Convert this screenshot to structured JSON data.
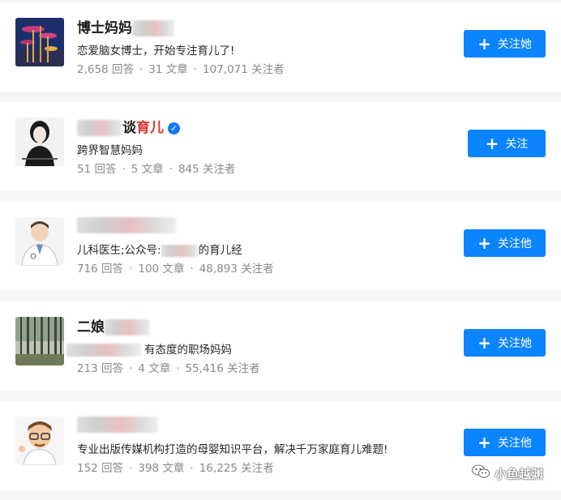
{
  "users": [
    {
      "name": "博士妈妈",
      "name_accent": "",
      "verified": false,
      "bio": "恋爱脑女博士，开始专注育儿了!",
      "answers": "2,658 回答",
      "articles": "31 文章",
      "followers": "107,071 关注者",
      "button_label": "关注她",
      "avatar_icon": "sculpture-avatar"
    },
    {
      "name": "谈",
      "name_accent": "育儿",
      "verified": true,
      "bio": "跨界智慧妈妈",
      "answers": "51 回答",
      "articles": "5 文章",
      "followers": "845 关注者",
      "button_label": "关注",
      "avatar_icon": "woman-sketch-avatar"
    },
    {
      "name": "",
      "name_accent": "",
      "verified": false,
      "bio_prefix": "儿科医生;公众号:",
      "bio_suffix": "的育儿经",
      "answers": "716 回答",
      "articles": "100 文章",
      "followers": "48,893 关注者",
      "button_label": "关注他",
      "avatar_icon": "doctor-avatar"
    },
    {
      "name": "二娘",
      "name_accent": "",
      "verified": false,
      "bio": "有态度的职场妈妈",
      "answers": "213 回答",
      "articles": "4 文章",
      "followers": "55,416 关注者",
      "button_label": "关注她",
      "avatar_icon": "forest-avatar"
    },
    {
      "name": "",
      "name_accent": "",
      "verified": false,
      "bio": "专业出版传媒机构打造的母婴知识平台，解决千万家庭育儿难题!",
      "answers": "152 回答",
      "articles": "398 文章",
      "followers": "16,225 关注者",
      "button_label": "关注他",
      "avatar_icon": "cartoon-doctor-avatar"
    }
  ],
  "separator": "·",
  "plus": "+",
  "verified_mark": "✓",
  "watermark": "小鱼越渊",
  "colors": {
    "accent": "#0a84ff",
    "name_accent": "#e0322c",
    "stats": "#8a8a8a"
  }
}
